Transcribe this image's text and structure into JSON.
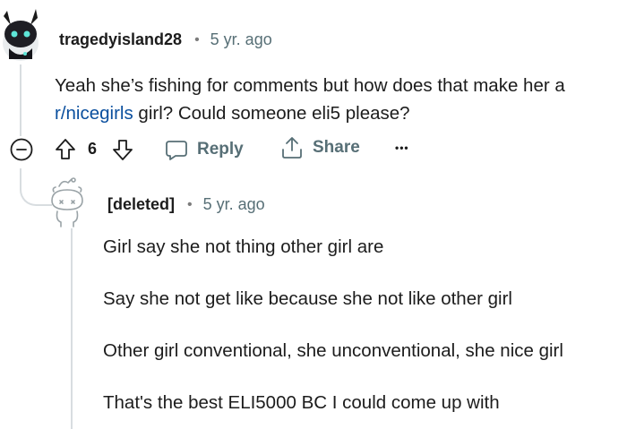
{
  "parent_comment": {
    "username": "tragedyisland28",
    "separator": "•",
    "time": "5 yr. ago",
    "body_line1": "Yeah she’s fishing for comments but how does that make her a",
    "body_link": "r/nicegirls",
    "body_line2_rest": " girl? Could someone eli5 please?",
    "actions": {
      "vote_count": "6",
      "reply_label": "Reply",
      "share_label": "Share",
      "more_label": "•••"
    }
  },
  "child_comment": {
    "username": "[deleted]",
    "separator": "•",
    "time": "5 yr. ago",
    "paragraphs": [
      "Girl say she not thing other girl are",
      "Say she not get like because she not like other girl",
      "Other girl conventional, she unconventional, she nice girl",
      "That's the best ELI5000 BC I could come up with"
    ]
  },
  "colors": {
    "text": "#1c1c1c",
    "muted": "#576f76",
    "link": "#0a4f9e",
    "thread": "#d8dde0"
  },
  "icons": {
    "collapse": "minus-circle-icon",
    "upvote": "arrow-up-icon",
    "downvote": "arrow-down-icon",
    "reply": "speech-bubble-icon",
    "share": "share-icon",
    "more": "ellipsis-icon"
  }
}
